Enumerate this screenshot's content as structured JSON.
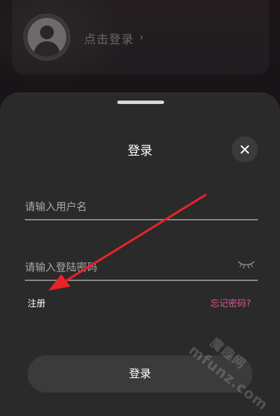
{
  "profile": {
    "login_prompt": "点击登录",
    "chevron": "›"
  },
  "sheet": {
    "title": "登录",
    "username": {
      "value": "",
      "placeholder": "请输入用户名"
    },
    "password": {
      "value": "",
      "placeholder": "请输入登陆密码"
    },
    "register_label": "注册",
    "forgot_label": "忘记密码?",
    "submit_label": "登录"
  },
  "watermark": {
    "cn": "魔趣网",
    "en": "mfunz.com"
  },
  "colors": {
    "sheet_bg": "#2a2a2a",
    "accent_pink": "#e0559a",
    "arrow_red": "#e8232a"
  }
}
